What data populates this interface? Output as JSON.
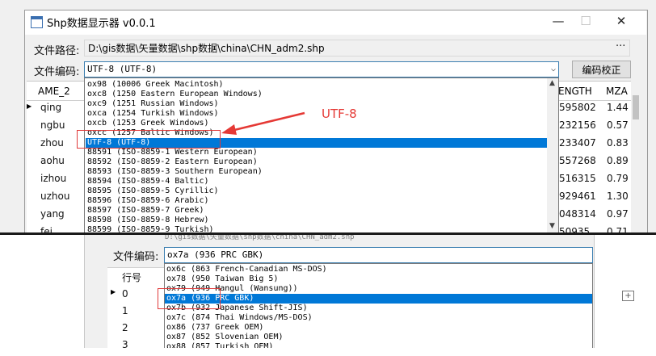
{
  "window": {
    "title": "Shp数据显示器 v0.0.1",
    "minimize": "—",
    "maximize": "☐",
    "close": "✕"
  },
  "form": {
    "path_label": "文件路径:",
    "path_value": "D:\\gis数据\\矢量数据\\shp数据\\china\\CHN_adm2.shp",
    "path_browse": "···",
    "encoding_label": "文件编码:",
    "encoding_value": "UTF-8 (UTF-8)",
    "verify_button": "编码校正"
  },
  "grid": {
    "col_left": "AME_2",
    "col_right_1": "ENGTH",
    "col_right_2": "MZA",
    "left_values": [
      "qing",
      "ngbu",
      "zhou",
      "aohu",
      "izhou",
      "uzhou",
      "yang",
      "fei"
    ],
    "right_length": [
      "595802",
      "232156",
      "233407",
      "557268",
      "516315",
      "929461",
      "048314",
      "50935"
    ],
    "right_mza": [
      "1.44",
      "0.57",
      "0.83",
      "0.89",
      "0.79",
      "1.30",
      "0.97",
      "0.71"
    ]
  },
  "encoding_options": [
    "ox98 (10006 Greek Macintosh)",
    "oxc8 (1250 Eastern European Windows)",
    "oxc9 (1251 Russian Windows)",
    "oxca (1254 Turkish Windows)",
    "oxcb (1253 Greek Windows)",
    "oxcc (1257 Baltic Windows)",
    "UTF-8 (UTF-8)",
    "88591 (ISO-8859-1 Western European)",
    "88592 (ISO-8859-2 Eastern European)",
    "88593 (ISO-8859-3 Southern European)",
    "88594 (ISO-8859-4 Baltic)",
    "88595 (ISO-8859-5 Cyrillic)",
    "88596 (ISO-8859-6 Arabic)",
    "88597 (ISO-8859-7 Greek)",
    "88598 (ISO-8859-8 Hebrew)",
    "88599 (ISO-8859-9 Turkish)"
  ],
  "annotation": "UTF-8",
  "bottom": {
    "faded_header": "D:\\gis数据\\矢量数据\\shp数据\\china\\CHN_adm2.shp",
    "encoding_label": "文件编码:",
    "encoding_value": "ox7a (936 PRC GBK)",
    "row_header": "行号",
    "rows": [
      "0",
      "1",
      "2",
      "3"
    ],
    "options": [
      "ox6c (863 French-Canadian MS-DOS)",
      "ox78 (950 Taiwan Big 5)",
      "ox79 (949 Hangul (Wansung))",
      "ox7a (936 PRC GBK)",
      "ox7b (932 Japanese Shift-JIS)",
      "ox7c (874 Thai Windows/MS-DOS)",
      "ox86 (737 Greek OEM)",
      "ox87 (852 Slovenian OEM)",
      "ox88 (857 Turkish OEM)"
    ]
  },
  "colors": {
    "selection": "#0078d7",
    "annotation_red": "#e53935",
    "focus_border": "#3c7fb1"
  }
}
